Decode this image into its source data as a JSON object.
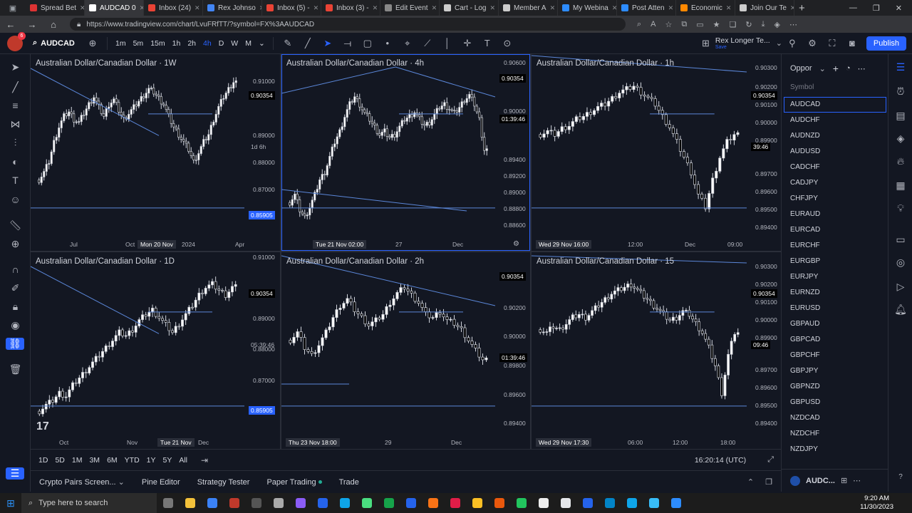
{
  "browser": {
    "tabs": [
      {
        "label": "Spread Bet",
        "color": "#d33"
      },
      {
        "label": "AUDCAD 0",
        "color": "#fff",
        "active": true
      },
      {
        "label": "Inbox (24)",
        "color": "#ea4335"
      },
      {
        "label": "Rex Johnso",
        "color": "#4285f4"
      },
      {
        "label": "Inbox (5) -",
        "color": "#ea4335"
      },
      {
        "label": "Inbox (3) -",
        "color": "#ea4335"
      },
      {
        "label": "Edit Event",
        "color": "#888"
      },
      {
        "label": "Cart - Log",
        "color": "#ccc"
      },
      {
        "label": "Member A",
        "color": "#ccc"
      },
      {
        "label": "My Webina",
        "color": "#2d8cff"
      },
      {
        "label": "Post Atten",
        "color": "#2d8cff"
      },
      {
        "label": "Economic",
        "color": "#f80"
      },
      {
        "label": "Join Our Te",
        "color": "#ccc"
      }
    ],
    "url": "https://www.tradingview.com/chart/LvuFRfTT/?symbol=FX%3AAUDCAD"
  },
  "toolbar": {
    "symbol": "AUDCAD",
    "timeframes": [
      "1m",
      "5m",
      "15m",
      "1h",
      "2h",
      "4h",
      "D",
      "W",
      "M"
    ],
    "active_timeframe": "4h",
    "layout_name": "Rex Longer Te...",
    "layout_sub": "Save",
    "publish": "Publish"
  },
  "charts": [
    {
      "title": "Australian Dollar/Canadian Dollar · 1W",
      "price_labels": [
        "0.91000",
        "0.89000",
        "0.88000",
        "0.87000"
      ],
      "price_tag": "0.90354",
      "countdown": "1d 6h",
      "line_tag": "0.85905",
      "time_labels": [
        "Jul",
        "Oct",
        "2024",
        "Apr"
      ],
      "crosshair_time": "Mon 20 Nov"
    },
    {
      "title": "Australian Dollar/Canadian Dollar · 4h",
      "price_labels": [
        "0.90600",
        "0.90000",
        "0.89400",
        "0.89200",
        "0.89000",
        "0.88800",
        "0.88600"
      ],
      "price_tag": "0.90354",
      "countdown": "01:39:46",
      "time_labels": [
        "27",
        "Dec"
      ],
      "crosshair_time": "Tue 21 Nov   02:00"
    },
    {
      "title": "Australian Dollar/Canadian Dollar · 1h",
      "price_labels": [
        "0.90300",
        "0.90200",
        "0.90100",
        "0.90000",
        "0.89900",
        "0.89700",
        "0.89600",
        "0.89500",
        "0.89400"
      ],
      "price_tag": "0.90354",
      "countdown": "39:46",
      "time_labels": [
        "12:00",
        "Dec",
        "09:00"
      ],
      "crosshair_time": "Wed 29 Nov   16:00"
    },
    {
      "title": "Australian Dollar/Canadian Dollar · 1D",
      "price_labels": [
        "0.91000",
        "0.89000",
        "0.88000",
        "0.87000"
      ],
      "price_tag": "0.90354",
      "countdown": "05:39:46",
      "line_tag": "0.85905",
      "time_labels": [
        "Oct",
        "Nov",
        "Dec"
      ],
      "crosshair_time": "Tue 21 Nov"
    },
    {
      "title": "Australian Dollar/Canadian Dollar · 2h",
      "price_labels": [
        "0.90400",
        "0.90200",
        "0.90000",
        "0.89800",
        "0.89600",
        "0.89400"
      ],
      "price_tag": "0.90354",
      "countdown": "01:39:46",
      "time_labels": [
        "29",
        "Dec"
      ],
      "crosshair_time": "Thu 23 Nov   18:00"
    },
    {
      "title": "Australian Dollar/Canadian Dollar · 15",
      "price_labels": [
        "0.90300",
        "0.90200",
        "0.90100",
        "0.90000",
        "0.89900",
        "0.89700",
        "0.89600",
        "0.89500",
        "0.89400"
      ],
      "price_tag": "0.90354",
      "countdown": "09:46",
      "time_labels": [
        "06:00",
        "12:00",
        "18:00"
      ],
      "crosshair_time": "Wed 29 Nov   17:30"
    }
  ],
  "rangebar": {
    "ranges": [
      "1D",
      "5D",
      "1M",
      "3M",
      "6M",
      "YTD",
      "1Y",
      "5Y",
      "All"
    ],
    "clock": "16:20:14 (UTC)"
  },
  "bottom_tabs": [
    "Crypto Pairs Screen...",
    "Pine Editor",
    "Strategy Tester",
    "Paper Trading",
    "Trade"
  ],
  "watchlist": {
    "title": "Oppor",
    "column": "Symbol",
    "selected": "AUDCAD",
    "symbols": [
      "AUDCAD",
      "AUDCHF",
      "AUDNZD",
      "AUDUSD",
      "CADCHF",
      "CADJPY",
      "CHFJPY",
      "EURAUD",
      "EURCAD",
      "EURCHF",
      "EURGBP",
      "EURJPY",
      "EURNZD",
      "EURUSD",
      "GBPAUD",
      "GBPCAD",
      "GBPCHF",
      "GBPJPY",
      "GBPNZD",
      "GBPUSD",
      "NZDCAD",
      "NZDCHF",
      "NZDJPY"
    ],
    "footer_symbol": "AUDC..."
  },
  "taskbar": {
    "search_placeholder": "Type here to search",
    "time": "9:20 AM",
    "date": "11/30/2023"
  },
  "colors": {
    "background": "#131722",
    "accent": "#2962ff",
    "bull": "#ffffff",
    "bear": "#000000",
    "trendline": "#5b87d9"
  }
}
